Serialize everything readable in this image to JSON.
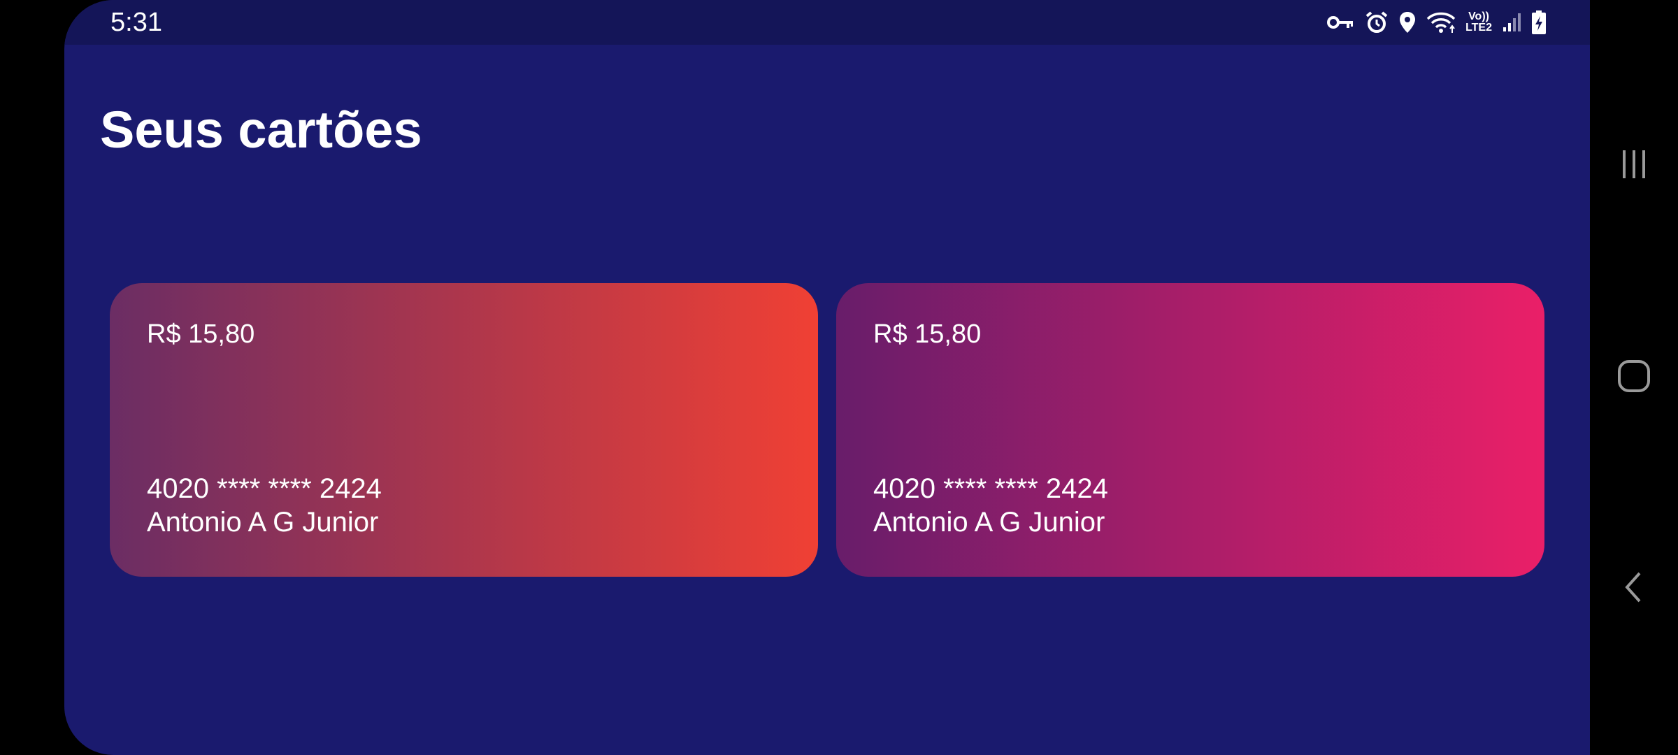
{
  "status_bar": {
    "time": "5:31",
    "icons": [
      "vpn-key-icon",
      "alarm-icon",
      "location-icon",
      "wifi-icon",
      "volte-lte2-icon",
      "signal-icon",
      "battery-charging-icon"
    ],
    "volte_label": "Vo))",
    "lte_label": "LTE2"
  },
  "page": {
    "title": "Seus cartões",
    "background_color": "#1a1a6e"
  },
  "cards": [
    {
      "balance": "R$ 15,80",
      "number": "4020 **** **** 2424",
      "holder": "Antonio A G Junior",
      "gradient_start": "#6b2d64",
      "gradient_end": "#f04034"
    },
    {
      "balance": "R$ 15,80",
      "number": "4020 **** **** 2424",
      "holder": "Antonio A G Junior",
      "gradient_start": "#681d6a",
      "gradient_end": "#ea1f68"
    }
  ],
  "nav_bar": {
    "buttons": [
      "recent-apps-icon",
      "home-icon",
      "back-icon"
    ]
  }
}
